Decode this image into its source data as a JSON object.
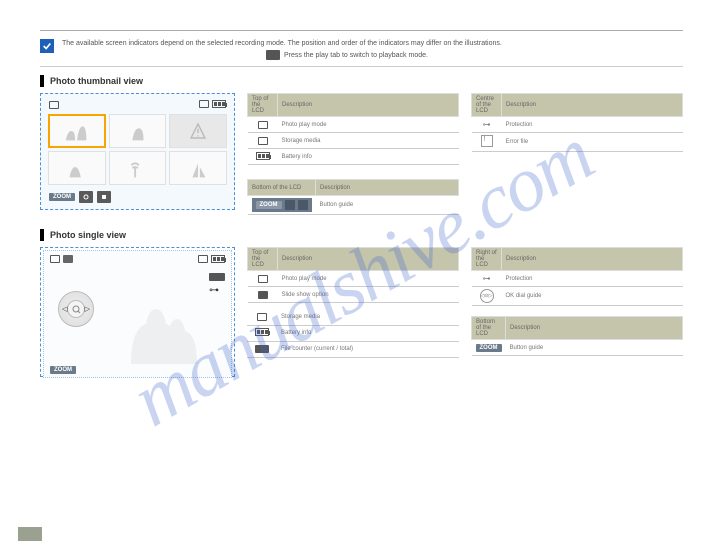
{
  "watermark": "manualshive.com",
  "intro": {
    "text": "The available screen indicators depend on the selected recording mode. The position and order of the indicators may differ on the illustrations.",
    "play_note": "Press the play tab to switch to playback mode."
  },
  "sections": {
    "thumb": {
      "title": "Photo thumbnail view"
    },
    "single": {
      "title": "Photo single view"
    }
  },
  "lcd_thumb": {
    "zoom": "ZOOM"
  },
  "lcd_single": {
    "zoom": "ZOOM"
  },
  "subbar": {
    "zoom": "ZOOM"
  },
  "table_thumb_left": {
    "header_icon": "Top of the LCD",
    "header_desc": "Description",
    "rows": [
      {
        "icon": "photo-mode-icon",
        "desc": "Photo play mode"
      },
      {
        "icon": "storage-icon",
        "desc": "Storage media"
      },
      {
        "icon": "battery-icon",
        "desc": "Battery info"
      }
    ]
  },
  "table_thumb_right": {
    "header_icon": "Centre of the LCD",
    "header_desc": "Description",
    "rows": [
      {
        "icon": "protection-key-icon",
        "desc": "Protection"
      },
      {
        "icon": "error-file-icon",
        "desc": "Error file"
      }
    ]
  },
  "table_thumb_bottom": {
    "header_icon": "Bottom of the LCD",
    "header_desc": "Description",
    "rows": [
      {
        "icon": "button-guide-icon",
        "desc": "Button guide"
      }
    ]
  },
  "table_single_left1": {
    "header_icon": "Top of the LCD",
    "header_desc": "Description",
    "rows": [
      {
        "icon": "photo-mode-icon",
        "desc": "Photo play mode"
      },
      {
        "icon": "slideshow-icon",
        "desc": "Slide show option"
      }
    ]
  },
  "table_single_left2": {
    "rows": [
      {
        "icon": "storage-icon",
        "desc": "Storage media"
      },
      {
        "icon": "battery-icon",
        "desc": "Battery info"
      },
      {
        "icon": "counter-icon",
        "desc": "File counter (current / total)"
      }
    ]
  },
  "table_single_right1": {
    "header_icon": "Right of the LCD",
    "header_desc": "Description",
    "rows": [
      {
        "icon": "protection-key-icon",
        "desc": "Protection"
      },
      {
        "icon": "ok-dial-icon",
        "desc": "OK dial guide"
      }
    ]
  },
  "table_single_right2": {
    "header_icon": "Bottom of the LCD",
    "header_desc": "Description",
    "rows": [
      {
        "icon": "zoom-button-icon",
        "desc": "Button guide"
      }
    ]
  }
}
